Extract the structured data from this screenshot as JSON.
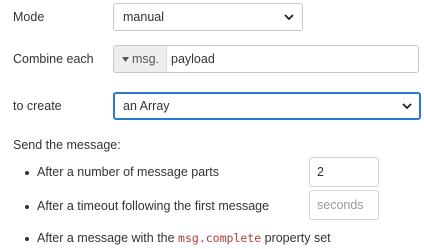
{
  "mode": {
    "label": "Mode",
    "value": "manual"
  },
  "combine": {
    "label": "Combine each",
    "type_prefix": "msg.",
    "value": "payload"
  },
  "create": {
    "label": "to create",
    "value": "an Array"
  },
  "send": {
    "heading": "Send the message:",
    "parts": {
      "text": "After a number of message parts",
      "value": "2"
    },
    "timeout": {
      "text": "After a timeout following the first message",
      "placeholder": "seconds"
    },
    "complete": {
      "text_before": "After a message with the ",
      "code": "msg.complete",
      "text_after": " property set"
    }
  },
  "colors": {
    "focus": "#2a77d6",
    "code": "#b03b3b"
  },
  "icons": {
    "select_arrow": "chevron-down-icon",
    "type_caret": "caret-down-icon"
  }
}
